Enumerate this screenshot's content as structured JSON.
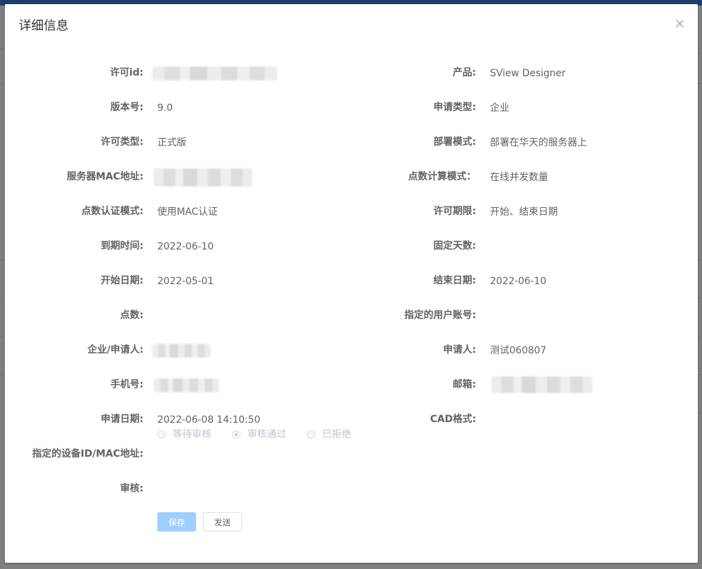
{
  "dialog": {
    "title": "详细信息"
  },
  "fields": {
    "license_id": {
      "label": "许可id:"
    },
    "product": {
      "label": "产品:",
      "value": "SView Designer"
    },
    "version": {
      "label": "版本号:",
      "value": "9.0"
    },
    "apply_type": {
      "label": "申请类型:",
      "value": "企业"
    },
    "license_type": {
      "label": "许可类型:",
      "value": "正式版"
    },
    "deploy_mode": {
      "label": "部署模式:",
      "value": "部署在华天的服务器上"
    },
    "server_mac": {
      "label": "服务器MAC地址:"
    },
    "point_calc_mode": {
      "label": "点数计算模式：",
      "value": "在线并发数量"
    },
    "point_auth_mode": {
      "label": "点数认证模式:",
      "value": "使用MAC认证"
    },
    "license_term": {
      "label": "许可期限:",
      "value": "开始、结束日期"
    },
    "expire_time": {
      "label": "到期时间:",
      "value": "2022-06-10"
    },
    "fixed_days": {
      "label": "固定天数:",
      "value": ""
    },
    "start_date": {
      "label": "开始日期:",
      "value": "2022-05-01"
    },
    "end_date": {
      "label": "结束日期:",
      "value": "2022-06-10"
    },
    "points": {
      "label": "点数:",
      "value": ""
    },
    "assigned_user": {
      "label": "指定的用户账号:",
      "value": ""
    },
    "company_applicant": {
      "label": "企业/申请人:"
    },
    "applicant": {
      "label": "申请人:",
      "value": "测试060807"
    },
    "phone": {
      "label": "手机号:"
    },
    "email": {
      "label": "邮箱:"
    },
    "apply_date": {
      "label": "申请日期:",
      "value": "2022-06-08 14:10:50"
    },
    "cad_format": {
      "label": "CAD格式:",
      "value": ""
    },
    "device_id": {
      "label": "指定的设备ID/MAC地址:",
      "value": ""
    },
    "review": {
      "label": "审核:"
    }
  },
  "review_options": [
    {
      "label": "等待审核",
      "checked": false
    },
    {
      "label": "审核通过",
      "checked": true
    },
    {
      "label": "已拒绝",
      "checked": false
    }
  ],
  "buttons": {
    "save": "保存",
    "send": "发送"
  },
  "colors": {
    "primary_disabled": "#a0cfff",
    "text": "#606266",
    "title": "#303133",
    "disabled_text": "#c0c4cc"
  }
}
